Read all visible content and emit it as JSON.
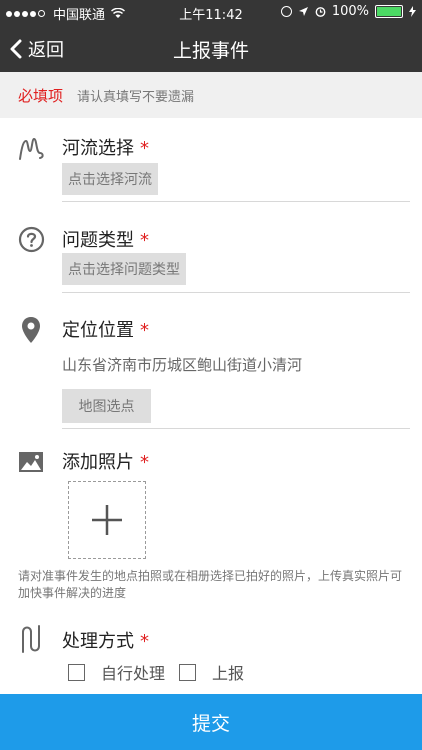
{
  "status": {
    "carrier": "中国联通",
    "time": "上午11:42",
    "battery": "100%"
  },
  "nav": {
    "back_label": "返回",
    "title": "上报事件"
  },
  "notice": {
    "required": "必填项",
    "hint": "请认真填写不要遗漏"
  },
  "form": {
    "river": {
      "label": "河流选择",
      "star": "*",
      "button": "点击选择河流"
    },
    "issue": {
      "label": "问题类型",
      "star": "*",
      "button": "点击选择问题类型"
    },
    "location": {
      "label": "定位位置",
      "star": "*",
      "address": "山东省济南市历城区鲍山街道小清河",
      "button": "地图选点"
    },
    "photo": {
      "label": "添加照片",
      "star": "*",
      "note": "请对准事件发生的地点拍照或在相册选择已拍好的照片，上传真实照片可加快事件解决的进度"
    },
    "handling": {
      "label": "处理方式",
      "star": "*",
      "options": [
        "自行处理",
        "上报"
      ]
    }
  },
  "submit_label": "提交",
  "colors": {
    "header_bg": "#363636",
    "required_red": "#e02020",
    "submit_blue": "#1e9be9"
  }
}
